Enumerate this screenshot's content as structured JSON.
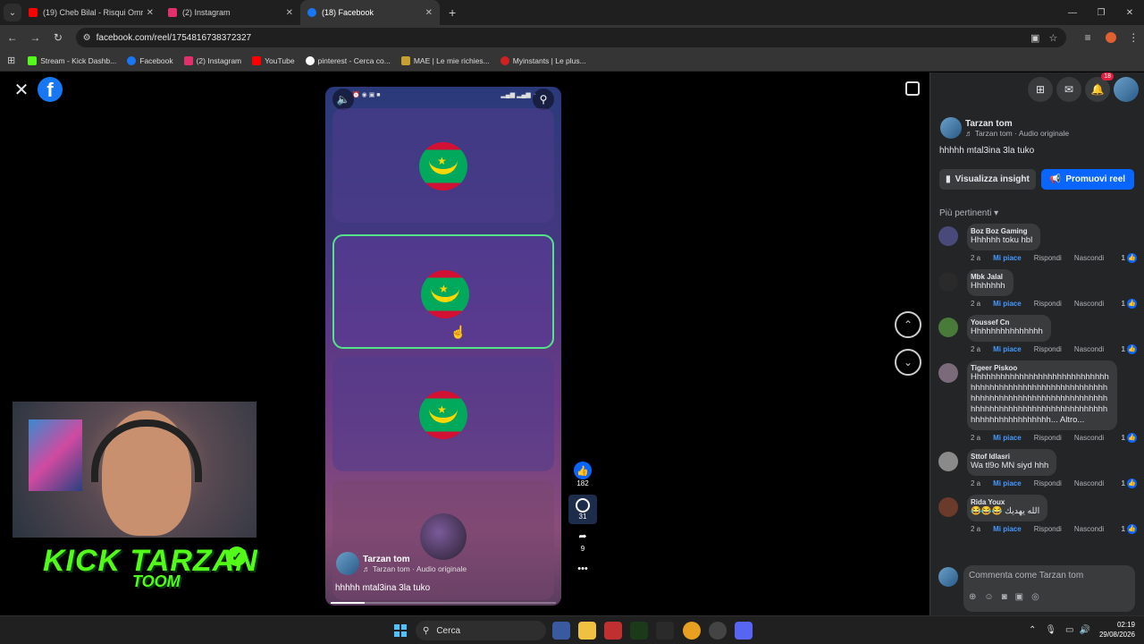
{
  "browser": {
    "tabs": [
      {
        "label": "(19) Cheb Bilal - Risqui Omri - Y",
        "color": "#ff0000"
      },
      {
        "label": "(2) Instagram",
        "color": "#e1306c"
      },
      {
        "label": "(18) Facebook",
        "color": "#1877f2"
      }
    ],
    "url": "facebook.com/reel/1754816738372327",
    "bookmarks": [
      {
        "label": "Stream - Kick Dashb...",
        "color": "#53fc18"
      },
      {
        "label": "Facebook",
        "color": "#1877f2"
      },
      {
        "label": "(2) Instagram",
        "color": "#e1306c"
      },
      {
        "label": "YouTube",
        "color": "#ff0000"
      },
      {
        "label": "pinterest - Cerca co...",
        "color": "#ffffff"
      },
      {
        "label": "MAE | Le mie richies...",
        "color": "#c8a030"
      },
      {
        "label": "Myinstants | Le plus...",
        "color": "#d02020"
      }
    ]
  },
  "reel": {
    "author": "Tarzan tom",
    "audio": "♬ Tarzan tom · Audio originale",
    "caption": "hhhhh mtal3ina 3la tuko",
    "likes": "182",
    "comments": "31",
    "shares": "9",
    "progress": 0.15
  },
  "stream_overlay": {
    "brand": "KICK TARZAN",
    "sub": "TOOM"
  },
  "panel": {
    "notif_count": "18",
    "author": "Tarzan tom",
    "audio": "♬ Tarzan tom · Audio originale",
    "text": "hhhhh mtal3ina 3la tuko",
    "insight_label": "Visualizza insight",
    "promote_label": "Promuovi reel",
    "sort_label": "Più pertinenti",
    "comments": [
      {
        "author": "Boz Boz Gaming",
        "text": "Hhhhhh toku hbl",
        "time": "2 a",
        "likes": "1",
        "avatar": "#4a4a7a"
      },
      {
        "author": "Mbk Jalal",
        "text": "Hhhhhhh",
        "time": "2 a",
        "likes": "1",
        "avatar": "#2a2a2a"
      },
      {
        "author": "Youssef Cn",
        "text": "Hhhhhhhhhhhhhhh",
        "time": "2 a",
        "likes": "1",
        "avatar": "#4a7a3a"
      },
      {
        "author": "Tigeer Piskoo",
        "text": "Hhhhhhhhhhhhhhhhhhhhhhhhhhhhhhhhhhhhhhhhhhhhhhhhhhhhhhhhhhhhhhhhhhhhhhhhhhhhhhhhhhhhhhhhhhhhhhhhhhhhhhhhhhhhhhhhhhhhhhhhhhhhhhhhhhhhh... Altro...",
        "time": "2 a",
        "likes": "1",
        "avatar": "#7a6a7a"
      },
      {
        "author": "Sttof Idlasri",
        "text": "Wa tl9o MN siyd hhh",
        "time": "2 a",
        "likes": "1",
        "avatar": "#8a8a8a"
      },
      {
        "author": "Rida Youx",
        "text": "😂😂😂 الله يهديك",
        "time": "2 a",
        "likes": "1",
        "avatar": "#6a3a2a"
      }
    ],
    "actions": {
      "like": "Mi piace",
      "reply": "Rispondi",
      "hide": "Nascondi"
    },
    "compose_placeholder": "Commenta come Tarzan tom"
  },
  "taskbar": {
    "search": "Cerca",
    "time": "02:19",
    "date": "29/08/2026"
  }
}
